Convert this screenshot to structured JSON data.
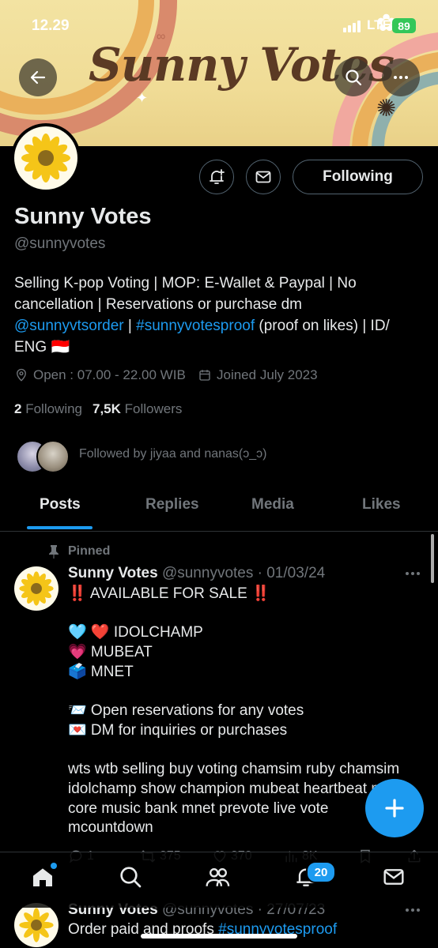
{
  "status_bar": {
    "time": "12.29",
    "network": "LTE",
    "battery": "89"
  },
  "banner": {
    "title": "Sunny Votes"
  },
  "profile": {
    "name": "Sunny Votes",
    "handle": "@sunnyvotes",
    "following_button": "Following",
    "bio_line1": "Selling K-pop Voting | MOP: E-Wallet & Paypal | No cancellation | Reservations or purchase dm ",
    "bio_link1": "@sunnyvtsorder",
    "bio_sep": " | ",
    "bio_link2": "#sunnyvotesproof",
    "bio_tail": " (proof on likes) | ID/ ENG 🇮🇩",
    "location": "Open : 07.00 - 22.00 WIB",
    "joined": "Joined July 2023",
    "following_count": "2",
    "following_label": "Following",
    "followers_count": "7,5K",
    "followers_label": "Followers",
    "followed_by": "Followed by jiyaa and nanas(ↄ_ↄ)"
  },
  "tabs": [
    {
      "label": "Posts",
      "active": true
    },
    {
      "label": "Replies"
    },
    {
      "label": "Media"
    },
    {
      "label": "Likes"
    }
  ],
  "pinned_label": "Pinned",
  "tweet1": {
    "name": "Sunny Votes",
    "handle_date": "@sunnyvotes · 01/03/24",
    "body": "‼️ AVAILABLE FOR SALE ‼️\n\n🩵 ❤️ IDOLCHAMP\n💗 MUBEAT\n🗳️ MNET\n\n📨 Open reservations for any votes\n💌 DM for inquiries or purchases\n\nwts wtb selling buy voting chamsim ruby chamsim idolchamp show champion mubeat heartbeat music core music bank mnet prevote live vote mcountdown",
    "replies": "1",
    "reposts": "375",
    "likes": "370",
    "views": "8K"
  },
  "tweet2": {
    "name": "Sunny Votes",
    "handle_date": "@sunnyvotes · 27/07/23",
    "text": "Order paid and proofs ",
    "link": "#sunnyvotesproof"
  },
  "bottom_nav": {
    "notifications_badge": "20"
  }
}
